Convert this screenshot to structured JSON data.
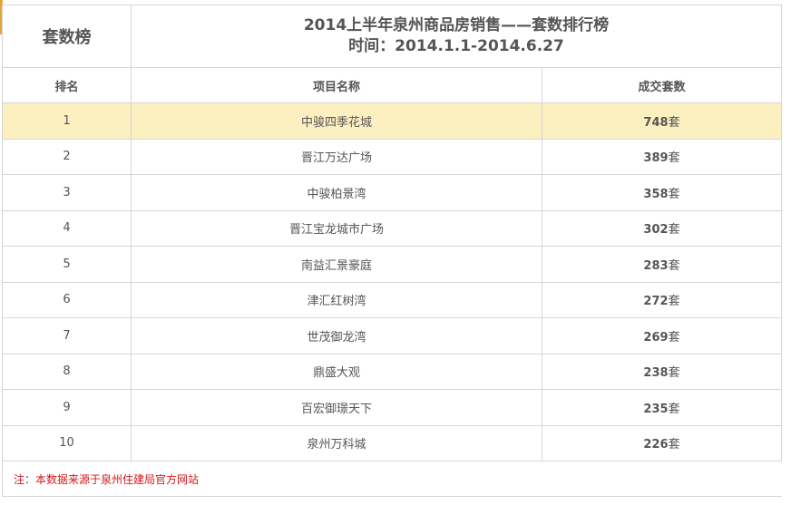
{
  "table": {
    "label": "套数榜",
    "title": "2014上半年泉州商品房销售——套数排行榜",
    "subtitle": "时间：2014.1.1-2014.6.27",
    "headers": {
      "rank": "排名",
      "name": "项目名称",
      "count": "成交套数"
    },
    "unit": "套",
    "highlight_color": "#fcefc0",
    "rows": [
      {
        "rank": "1",
        "name": "中骏四季花城",
        "count": "748"
      },
      {
        "rank": "2",
        "name": "晋江万达广场",
        "count": "389"
      },
      {
        "rank": "3",
        "name": "中骏柏景湾",
        "count": "358"
      },
      {
        "rank": "4",
        "name": "晋江宝龙城市广场",
        "count": "302"
      },
      {
        "rank": "5",
        "name": "南益汇景豪庭",
        "count": "283"
      },
      {
        "rank": "6",
        "name": "津汇红树湾",
        "count": "272"
      },
      {
        "rank": "7",
        "name": "世茂御龙湾",
        "count": "269"
      },
      {
        "rank": "8",
        "name": "鼎盛大观",
        "count": "238"
      },
      {
        "rank": "9",
        "name": "百宏御璟天下",
        "count": "235"
      },
      {
        "rank": "10",
        "name": "泉州万科城",
        "count": "226"
      }
    ],
    "note": "注：本数据来源于泉州住建局官方网站"
  }
}
